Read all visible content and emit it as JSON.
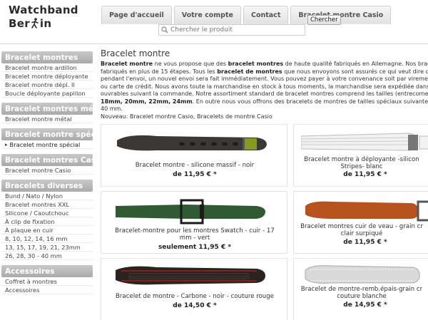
{
  "logo": {
    "line1": "Watchband",
    "line2_a": "Ber",
    "line2_b": "in"
  },
  "nav": {
    "tabs": [
      "Page d'accueil",
      "Votre compte",
      "Contact",
      "Bracelet montre Casio"
    ]
  },
  "search": {
    "placeholder": "Chercher le produit",
    "button": "Chercher"
  },
  "sidebar": {
    "categories": [
      {
        "title": "Bracelet montres",
        "items": [
          "Bracelet montre ardillon",
          "Bracelet montre déployante",
          "Bracelet montre dépl. II",
          "Boucle déployante papillon"
        ]
      },
      {
        "title": "Bracelet montres métal",
        "items": [
          "Bracelet montre métal"
        ]
      },
      {
        "title": "Bracelet montre spécial",
        "items": [
          "Bracelet montre spécial"
        ]
      },
      {
        "title": "Bracelet montres Casio",
        "items": [
          "Bracelet montre Casio"
        ]
      },
      {
        "title": "Bracelets diverses",
        "items": [
          "Bund / Nato / Nylon",
          "Bracelet montres XXL",
          "Silicone / Caoutchouc",
          "À clip de fixation",
          "À plaque en cuir",
          "8, 10, 12, 14, 16 mm",
          "13, 15, 17, 19, 21, 23mm",
          "26, 28, 30 - 40 mm"
        ]
      },
      {
        "title": "Accessoires",
        "items": [
          "Coffret à montres",
          "Accessoires"
        ]
      }
    ]
  },
  "main": {
    "title": "Bracelet montre",
    "intro": [
      [
        "",
        "Bracelet montre",
        " ne vous propose que des ",
        "bracelet montres",
        " de haute qualité fabriqués en Allemagne. Nos bracelet"
      ],
      [
        "fabriqués en plus de 15 étapes. Tous les ",
        "bracelet de montres",
        " que nous envoyons sont assurés ce qui veut dire que"
      ],
      [
        "pendant l'envoi, un nouvel envoi sera fait immédiatement. Vous pouvez payer à votre convenance soit par virement",
        "",
        "",
        "",
        ""
      ],
      [
        "ou carte de crédit. Nous avons toute la marchandise en stock à tous moments, la marchandise sera expédiée dans les",
        "",
        "",
        "",
        ""
      ],
      [
        "ouvrables suivant la commande. Notre assortiment standard de bracelet montres comprend les tailles (entrecornes)",
        "",
        "",
        "",
        ""
      ],
      [
        "18mm, 20mm, 22mm, 24mm",
        ". En outre nous vous offrons des bracelets de montres de tailles spéciaux suivantes:",
        "",
        "",
        ""
      ],
      [
        "40 mm.",
        "",
        "",
        "",
        ""
      ],
      [
        "Nouveau: Bracelet montre Casio, Bracelets de montre Casio",
        "",
        "",
        "",
        ""
      ]
    ],
    "products": [
      {
        "name": [
          "Bracelet montre - silicone massif - noir"
        ],
        "price_prefix": "de ",
        "price": "11,95 € *",
        "color": "#3b3835"
      },
      {
        "name": [
          "Bracelet montre à déployante -silicon",
          "Stripes- blanc"
        ],
        "price_prefix": "de ",
        "price": "11,95 € *",
        "color": "#f2f2f2"
      },
      {
        "name": [
          "Bracelet-montre pour les montres Swatch - cuir - 17",
          "mm - vert"
        ],
        "price_prefix": "seulement ",
        "price": "11,95 € *",
        "color": "#2f5a34"
      },
      {
        "name": [
          "Bracelet montres cuir de veau - grain cr",
          "clair surpiqué"
        ],
        "price_prefix": "de ",
        "price": "11,95 € *",
        "color": "#b8521f"
      },
      {
        "name": [
          "Bracelet de montre - Carbone - noir - couture rouge"
        ],
        "price_prefix": "de ",
        "price": "14,50 € *",
        "color": "#2a2320"
      },
      {
        "name": [
          "Bracelet de montre-remb.épais-grain cr",
          "couture blanche"
        ],
        "price_prefix": "de ",
        "price": "14,95 € *",
        "color": "#d9d9d9"
      }
    ]
  },
  "colors": {
    "sidebar_header": "#aaaaaa",
    "nav_tab": "#e2e2e2",
    "border": "#e3e3e3"
  }
}
